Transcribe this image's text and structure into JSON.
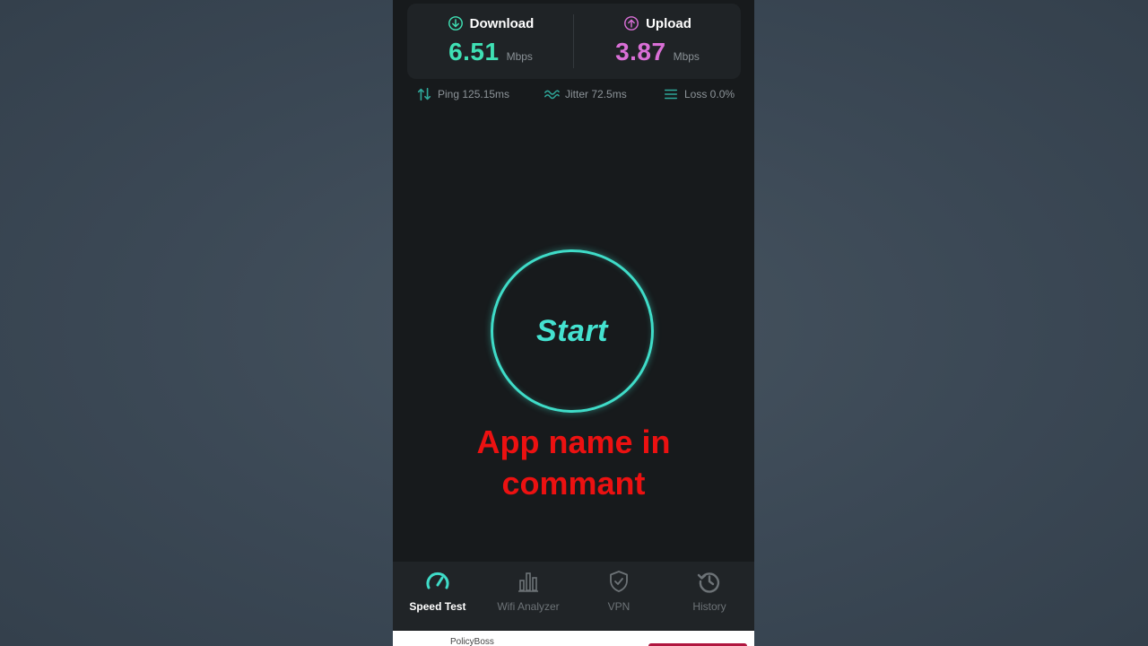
{
  "speed": {
    "download": {
      "label": "Download",
      "value": "6.51",
      "unit": "Mbps",
      "icon": "arrow-down-circle-icon",
      "color": "#3fe0b4"
    },
    "upload": {
      "label": "Upload",
      "value": "3.87",
      "unit": "Mbps",
      "icon": "arrow-up-circle-icon",
      "color": "#d96fd6"
    }
  },
  "stats": {
    "ping": "Ping 125.15ms",
    "jitter": "Jitter 72.5ms",
    "loss": "Loss 0.0%"
  },
  "start_button": {
    "label": "Start",
    "color": "#3fdcc8"
  },
  "overlay": {
    "line1": "App name in",
    "line2": "commant",
    "color": "#ec1111"
  },
  "nav": {
    "items": [
      {
        "label": "Speed Test",
        "icon": "speedometer-icon",
        "active": true
      },
      {
        "label": "Wifi Analyzer",
        "icon": "bar-chart-icon",
        "active": false
      },
      {
        "label": "VPN",
        "icon": "shield-check-icon",
        "active": false
      },
      {
        "label": "History",
        "icon": "history-clock-icon",
        "active": false
      }
    ]
  },
  "ad": {
    "label": "PolicyBoss"
  }
}
